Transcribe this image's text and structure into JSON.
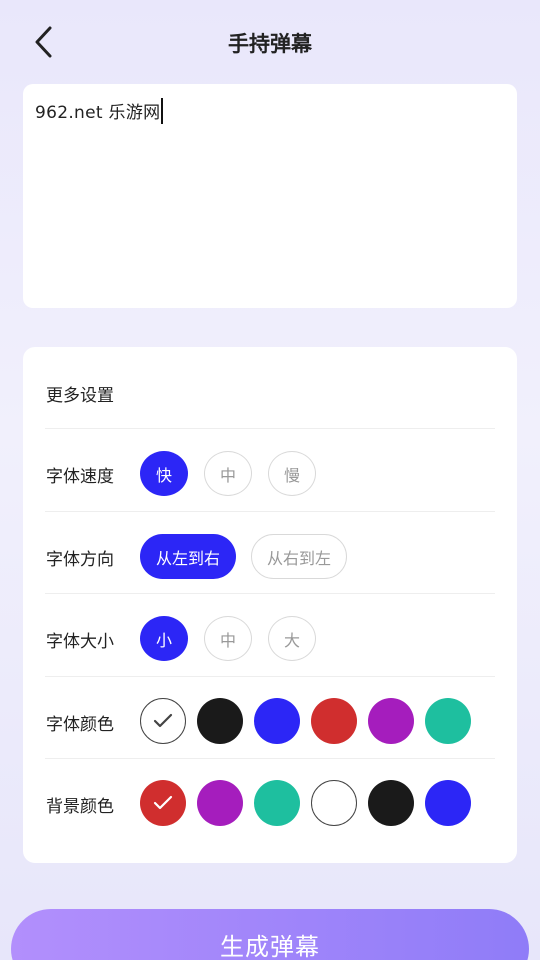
{
  "header": {
    "title": "手持弹幕"
  },
  "input": {
    "value": "962.net 乐游网"
  },
  "settings": {
    "title": "更多设置",
    "speed": {
      "label": "字体速度",
      "options": [
        "快",
        "中",
        "慢"
      ],
      "selected": "快"
    },
    "direction": {
      "label": "字体方向",
      "options": [
        "从左到右",
        "从右到左"
      ],
      "selected": "从左到右"
    },
    "size": {
      "label": "字体大小",
      "options": [
        "小",
        "中",
        "大"
      ],
      "selected": "小"
    },
    "font_color": {
      "label": "字体颜色",
      "swatches": [
        "#ffffff",
        "#1a1a1a",
        "#2c26f6",
        "#d02e2e",
        "#a51dbd",
        "#1ebf9f"
      ],
      "selected": "#ffffff"
    },
    "bg_color": {
      "label": "背景颜色",
      "swatches": [
        "#d02e2e",
        "#a51dbd",
        "#1ebf9f",
        "#ffffff",
        "#1a1a1a",
        "#2c26f6"
      ],
      "selected": "#d02e2e"
    }
  },
  "generate_button": {
    "label": "生成弹幕"
  },
  "colors": {
    "accent": "#2c26f6",
    "button_gradient_start": "#b28ffc",
    "button_gradient_end": "#8f7cf8"
  }
}
